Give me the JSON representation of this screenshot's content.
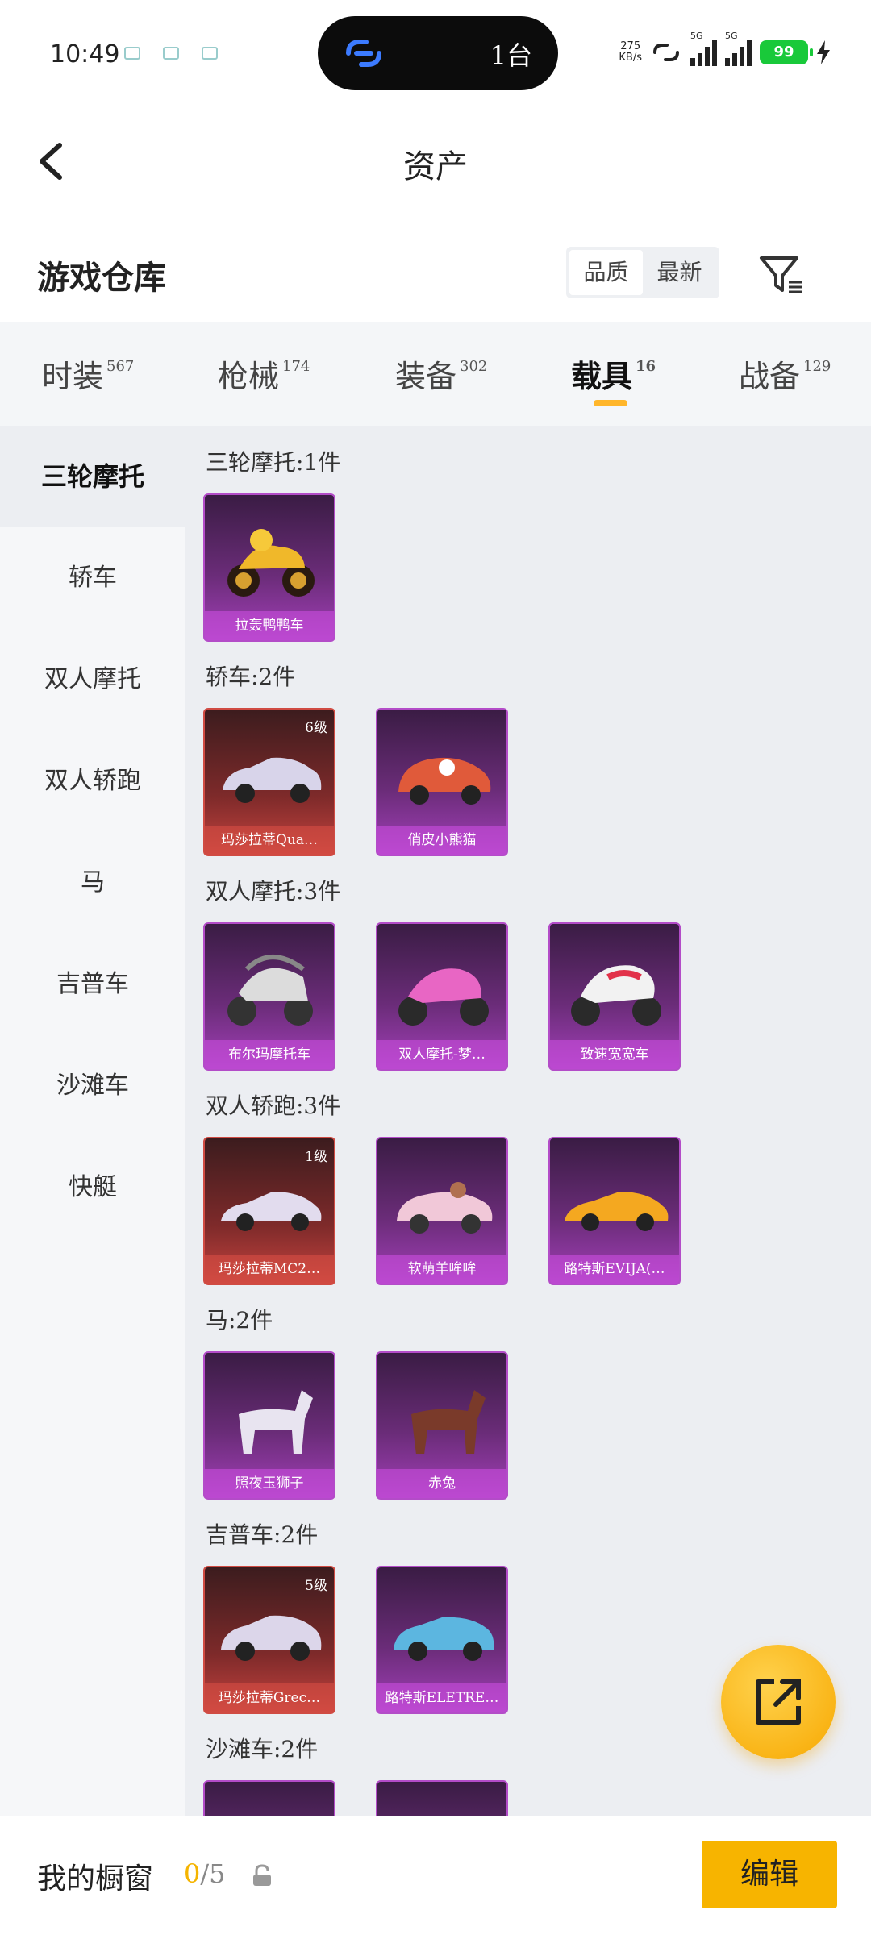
{
  "status_bar": {
    "time": "10:49",
    "island_text": "1台",
    "net_speed": "275",
    "net_unit": "KB/s",
    "sim1": "5G",
    "sim2": "5G",
    "battery": "99"
  },
  "header": {
    "title": "资产"
  },
  "warehouse": {
    "title": "游戏仓库",
    "sort_options": [
      "品质",
      "最新"
    ]
  },
  "tabs": [
    {
      "label": "时装",
      "count": "567"
    },
    {
      "label": "枪械",
      "count": "174"
    },
    {
      "label": "装备",
      "count": "302"
    },
    {
      "label": "载具",
      "count": "16"
    },
    {
      "label": "战备",
      "count": "129"
    }
  ],
  "sidebar": [
    "三轮摩托",
    "轿车",
    "双人摩托",
    "双人轿跑",
    "马",
    "吉普车",
    "沙滩车",
    "快艇"
  ],
  "sections": [
    {
      "title": "三轮摩托:1件",
      "items": [
        {
          "name": "拉轰鸭鸭车"
        }
      ]
    },
    {
      "title": "轿车:2件",
      "items": [
        {
          "name": "玛莎拉蒂Qua…",
          "level": "6级"
        },
        {
          "name": "俏皮小熊猫"
        }
      ]
    },
    {
      "title": "双人摩托:3件",
      "items": [
        {
          "name": "布尔玛摩托车"
        },
        {
          "name": "双人摩托-梦…"
        },
        {
          "name": "致速宽宽车"
        }
      ]
    },
    {
      "title": "双人轿跑:3件",
      "items": [
        {
          "name": "玛莎拉蒂MC2…",
          "level": "1级"
        },
        {
          "name": "软萌羊哞哞"
        },
        {
          "name": "路特斯EVIJA(…"
        }
      ]
    },
    {
      "title": "马:2件",
      "items": [
        {
          "name": "照夜玉狮子"
        },
        {
          "name": "赤兔"
        }
      ]
    },
    {
      "title": "吉普车:2件",
      "items": [
        {
          "name": "玛莎拉蒂Grec…",
          "level": "5级"
        },
        {
          "name": "路特斯ELETRE…"
        }
      ]
    },
    {
      "title": "沙滩车:2件",
      "items": []
    }
  ],
  "bottom": {
    "title": "我的橱窗",
    "current": "0",
    "total": "/5",
    "edit_label": "编辑"
  }
}
